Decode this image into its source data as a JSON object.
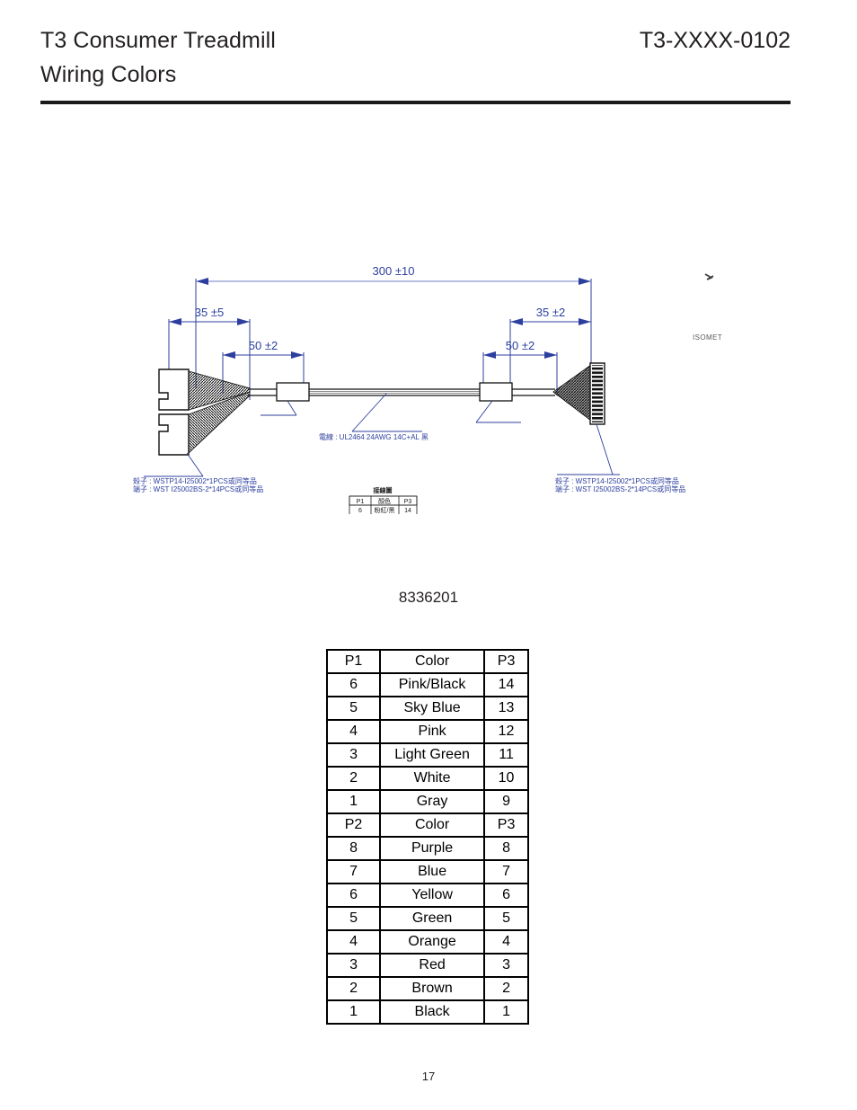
{
  "header": {
    "title_line1": "T3 Consumer Treadmill",
    "title_line2": "Wiring Colors",
    "doc_number": "T3-XXXX-0102"
  },
  "drawing": {
    "dimensions": {
      "overall_length": "300 ±10",
      "left_breakout": "35 ±5",
      "left_sleeve": "50 ±2",
      "right_sleeve": "50 ±2",
      "right_breakout": "35 ±2"
    },
    "notes": {
      "wire_spec": "電線 : UL2464 24AWG 14C+AL 黑",
      "left_housing": "殼子 : WSTP14-I25002*1PCS或同等品",
      "left_terminal": "端子 : WST I25002BS-2*14PCS或同等品",
      "right_housing": "殼子 : WSTP14-I25002*1PCS或同等品",
      "right_terminal": "端子 : WST I25002BS-2*14PCS或同等品"
    },
    "view_label": "ISOMET",
    "mini_table": {
      "title": "接線圖",
      "headers": [
        "P1",
        "顏色",
        "P3"
      ],
      "first_row": [
        "6",
        "粉紅/黑",
        "14"
      ]
    }
  },
  "part_number": "8336201",
  "wiring_table": {
    "headers_primary": [
      "P1",
      "Color",
      "P3"
    ],
    "headers_secondary": [
      "P2",
      "Color",
      "P3"
    ],
    "rows": [
      {
        "left": "P1",
        "color": "Color",
        "right": "P3",
        "is_header": true
      },
      {
        "left": "6",
        "color": "Pink/Black",
        "right": "14",
        "is_header": false
      },
      {
        "left": "5",
        "color": "Sky Blue",
        "right": "13",
        "is_header": false
      },
      {
        "left": "4",
        "color": "Pink",
        "right": "12",
        "is_header": false
      },
      {
        "left": "3",
        "color": "Light Green",
        "right": "11",
        "is_header": false
      },
      {
        "left": "2",
        "color": "White",
        "right": "10",
        "is_header": false
      },
      {
        "left": "1",
        "color": "Gray",
        "right": "9",
        "is_header": false
      },
      {
        "left": "P2",
        "color": "Color",
        "right": "P3",
        "is_header": true
      },
      {
        "left": "8",
        "color": "Purple",
        "right": "8",
        "is_header": false
      },
      {
        "left": "7",
        "color": "Blue",
        "right": "7",
        "is_header": false
      },
      {
        "left": "6",
        "color": "Yellow",
        "right": "6",
        "is_header": false
      },
      {
        "left": "5",
        "color": "Green",
        "right": "5",
        "is_header": false
      },
      {
        "left": "4",
        "color": "Orange",
        "right": "4",
        "is_header": false
      },
      {
        "left": "3",
        "color": "Red",
        "right": "3",
        "is_header": false
      },
      {
        "left": "2",
        "color": "Brown",
        "right": "2",
        "is_header": false
      },
      {
        "left": "1",
        "color": "Black",
        "right": "1",
        "is_header": false
      }
    ]
  },
  "footer": {
    "page_number": "17"
  },
  "colors": {
    "dimension_blue": "#2c3f9e",
    "text_black": "#231f20",
    "rule_black": "#1a1a1a"
  }
}
